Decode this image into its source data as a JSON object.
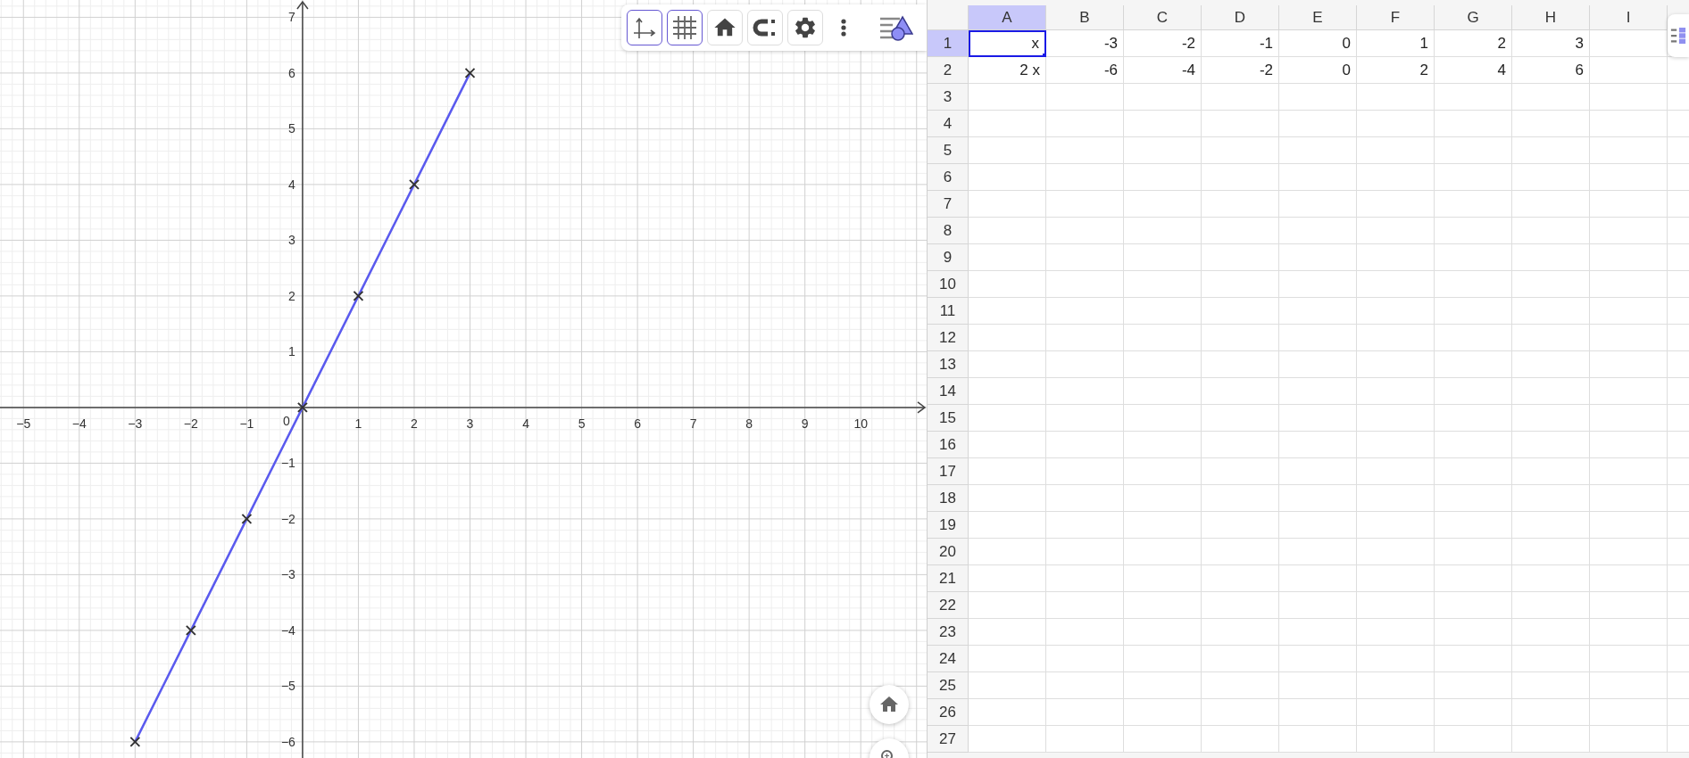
{
  "graphics": {
    "toolbar": [
      {
        "kind": "axes",
        "selected": true
      },
      {
        "kind": "grid",
        "selected": true
      },
      {
        "kind": "home",
        "selected": false
      },
      {
        "kind": "snap",
        "selected": false
      },
      {
        "kind": "settings",
        "selected": false
      },
      {
        "kind": "more"
      },
      {
        "kind": "view"
      }
    ],
    "chart_data": {
      "type": "line",
      "grid": true,
      "x": [
        -3,
        -2,
        -1,
        0,
        1,
        2,
        3
      ],
      "series": [
        {
          "color": "#5a5aee",
          "marker": "x",
          "values": [
            -6,
            -4,
            -2,
            0,
            2,
            4,
            6
          ]
        }
      ],
      "xlim": [
        -5.42,
        11.18
      ],
      "ylim": [
        -6.29,
        7.31
      ],
      "xticks": [
        {
          "value": -5,
          "label": "−5"
        },
        {
          "value": -4,
          "label": "−4"
        },
        {
          "value": -3,
          "label": "−3"
        },
        {
          "value": -2,
          "label": "−2"
        },
        {
          "value": -1,
          "label": "−1"
        },
        1,
        2,
        3,
        4,
        5,
        6,
        7,
        8,
        9,
        10
      ],
      "yticks": [
        {
          "value": -6,
          "label": "−6"
        },
        {
          "value": -5,
          "label": "−5"
        },
        {
          "value": -4,
          "label": "−4"
        },
        {
          "value": -3,
          "label": "−3"
        },
        {
          "value": -2,
          "label": "−2"
        },
        {
          "value": -1,
          "label": "−1"
        },
        1,
        2,
        3,
        4,
        5,
        6,
        7
      ]
    },
    "origin_label": "0",
    "floating_buttons": [
      {
        "kind": "home"
      },
      {
        "kind": "zoom_in"
      }
    ]
  },
  "spreadsheet": {
    "columns": [
      {
        "label": "A",
        "selected": true
      },
      {
        "label": "B",
        "selected": false
      },
      {
        "label": "C",
        "selected": false
      },
      {
        "label": "D",
        "selected": false
      },
      {
        "label": "E",
        "selected": false
      },
      {
        "label": "F",
        "selected": false
      },
      {
        "label": "G",
        "selected": false
      },
      {
        "label": "H",
        "selected": false
      },
      {
        "label": "I",
        "selected": false
      }
    ],
    "rows": [
      {
        "label": "1",
        "selected": true,
        "cells": [
          {
            "value": "x",
            "selected": true
          },
          {
            "value": "-3",
            "selected": false
          },
          {
            "value": "-2",
            "selected": false
          },
          {
            "value": "-1",
            "selected": false
          },
          {
            "value": "0",
            "selected": false
          },
          {
            "value": "1",
            "selected": false
          },
          {
            "value": "2",
            "selected": false
          },
          {
            "value": "3",
            "selected": false
          }
        ]
      },
      {
        "label": "2",
        "selected": false,
        "cells": [
          {
            "value": "2 x",
            "selected": false
          },
          {
            "value": "-6",
            "selected": false
          },
          {
            "value": "-4",
            "selected": false
          },
          {
            "value": "-2",
            "selected": false
          },
          {
            "value": "0",
            "selected": false
          },
          {
            "value": "2",
            "selected": false
          },
          {
            "value": "4",
            "selected": false
          },
          {
            "value": "6",
            "selected": false
          }
        ]
      },
      {
        "label": "3",
        "selected": false
      },
      {
        "label": "4",
        "selected": false
      },
      {
        "label": "5",
        "selected": false
      },
      {
        "label": "6",
        "selected": false
      },
      {
        "label": "7",
        "selected": false
      },
      {
        "label": "8",
        "selected": false
      },
      {
        "label": "9",
        "selected": false
      },
      {
        "label": "10",
        "selected": false
      },
      {
        "label": "11",
        "selected": false
      },
      {
        "label": "12",
        "selected": false
      },
      {
        "label": "13",
        "selected": false
      },
      {
        "label": "14",
        "selected": false
      },
      {
        "label": "15",
        "selected": false
      },
      {
        "label": "16",
        "selected": false
      },
      {
        "label": "17",
        "selected": false
      },
      {
        "label": "18",
        "selected": false
      },
      {
        "label": "19",
        "selected": false
      },
      {
        "label": "20",
        "selected": false
      },
      {
        "label": "21",
        "selected": false
      },
      {
        "label": "22",
        "selected": false
      },
      {
        "label": "23",
        "selected": false
      },
      {
        "label": "24",
        "selected": false
      },
      {
        "label": "25",
        "selected": false
      },
      {
        "label": "26",
        "selected": false
      },
      {
        "label": "27",
        "selected": false
      }
    ]
  }
}
